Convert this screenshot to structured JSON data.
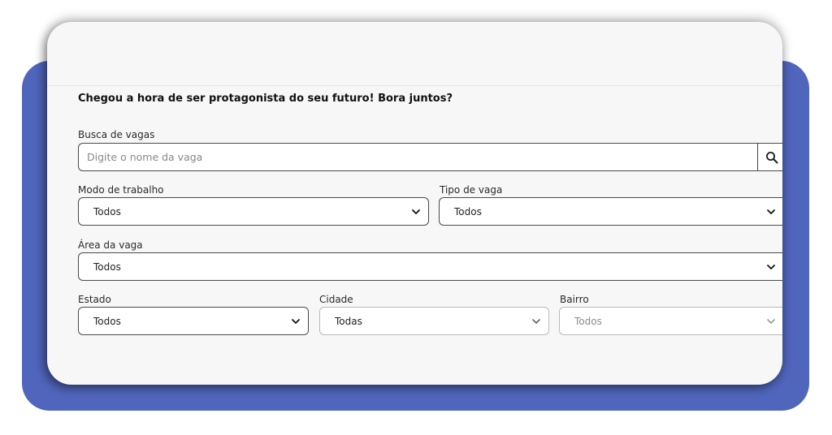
{
  "headline": "Chegou a hora de ser protagonista do seu futuro! Bora juntos?",
  "search": {
    "label": "Busca de vagas",
    "placeholder": "Digite o nome da vaga",
    "icon": "search-icon"
  },
  "filters": {
    "modo": {
      "label": "Modo de trabalho",
      "value": "Todos"
    },
    "tipo": {
      "label": "Tipo de vaga",
      "value": "Todos"
    },
    "area": {
      "label": "Área da vaga",
      "value": "Todos"
    },
    "estado": {
      "label": "Estado",
      "value": "Todos"
    },
    "cidade": {
      "label": "Cidade",
      "value": "Todas"
    },
    "bairro": {
      "label": "Bairro",
      "value": "Todos"
    }
  },
  "colors": {
    "background_panel": "#5065bc",
    "card": "#f7f7f7",
    "border": "#4a4a4a",
    "border_disabled": "#b9b9b9"
  }
}
